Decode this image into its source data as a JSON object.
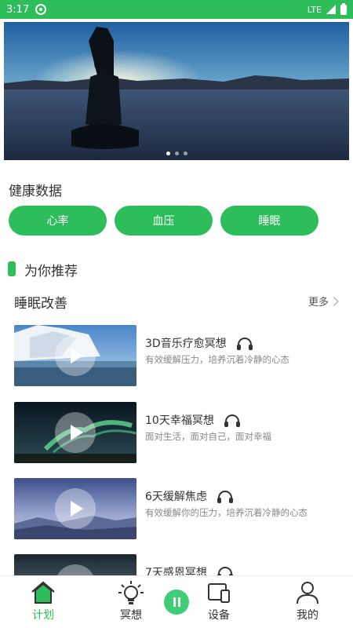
{
  "status_bar": {
    "time": "3:17",
    "network": "LTE"
  },
  "banner": {
    "dot_count": 3,
    "active_dot": 0
  },
  "health": {
    "title": "健康数据",
    "buttons": [
      {
        "label": "心率"
      },
      {
        "label": "血压"
      },
      {
        "label": "睡眠"
      }
    ]
  },
  "recommend": {
    "title": "为你推荐"
  },
  "sleep": {
    "title": "睡眠改善",
    "more_label": "更多",
    "items": [
      {
        "title": "3D音乐疗愈冥想",
        "desc": "有效缓解压力，培养沉着冷静的心态",
        "thumb": "iceberg"
      },
      {
        "title": "10天幸福冥想",
        "desc": "面对生活，面对自己，面对幸福",
        "thumb": "aurora"
      },
      {
        "title": "6天缓解焦虑",
        "desc": "有效缓解你的压力，培养沉着冷静的心态",
        "thumb": "mountains"
      },
      {
        "title": "7天感恩冥想",
        "desc": "",
        "thumb": "sky"
      }
    ]
  },
  "nav": {
    "items": [
      {
        "label": "计划",
        "icon": "home-icon",
        "active": true
      },
      {
        "label": "冥想",
        "icon": "lightbulb-icon",
        "active": false
      },
      {
        "label": "设备",
        "icon": "devices-icon",
        "active": false
      },
      {
        "label": "我的",
        "icon": "person-icon",
        "active": false
      }
    ]
  },
  "colors": {
    "accent": "#2ebd5b"
  }
}
